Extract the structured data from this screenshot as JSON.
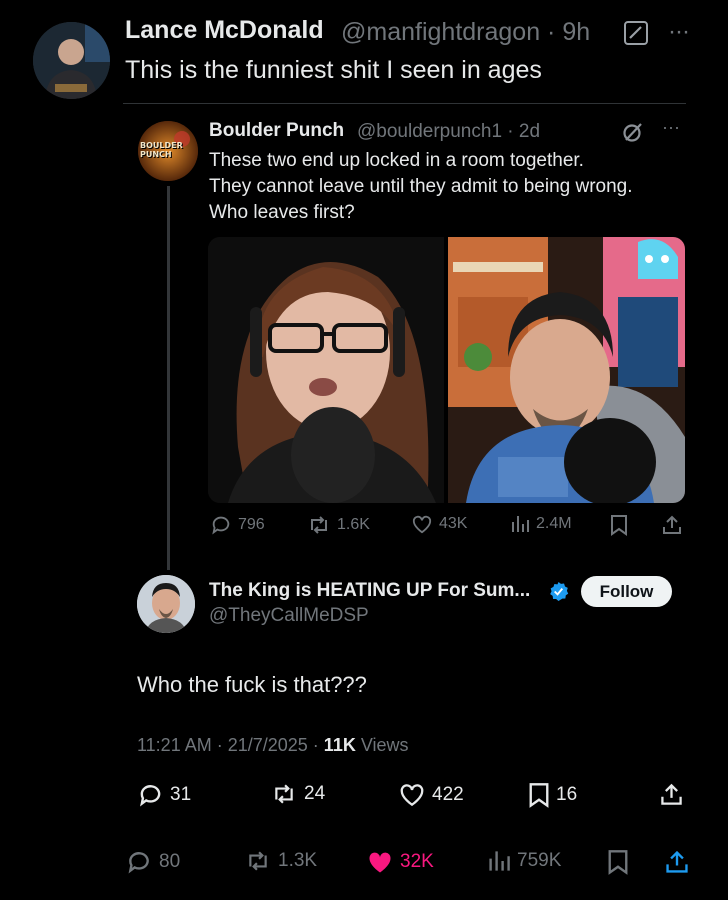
{
  "top_tweet": {
    "author_name": "Lance McDonald",
    "handle_time": "@manfightdragon · 9h",
    "text": "This is the funniest shit I seen in ages",
    "more": "···"
  },
  "quoted_tweet": {
    "author_name": "Boulder Punch",
    "handle_time": "@boulderpunch1 · 2d",
    "avatar_logo_text": "BOULDER PUNCH",
    "more": "···",
    "text_lines": [
      "These two end up locked in a room together.",
      "They cannot leave until they admit to being wrong.",
      "Who leaves first?"
    ],
    "stats": {
      "replies": "796",
      "reposts": "1.6K",
      "likes": "43K",
      "views": "2.4M"
    }
  },
  "reply": {
    "author_name": "The King is HEATING UP For Sum...",
    "handle": "@TheyCallMeDSP",
    "follow_label": "Follow",
    "text": "Who the fuck is that???",
    "timestamp": "11:21 AM · 21/7/2025 · ",
    "views_count": "11K",
    "views_label": " Views",
    "stats": {
      "replies": "31",
      "reposts": "24",
      "likes": "422",
      "bookmarks": "16"
    }
  },
  "bottom_bar": {
    "replies": "80",
    "reposts": "1.3K",
    "likes": "32K",
    "views": "759K"
  },
  "colors": {
    "background": "#000000",
    "text": "#e7e9ea",
    "muted": "#71767b",
    "like_active": "#f91880",
    "share_blue": "#1d9bf0",
    "verified": "#1d9bf0"
  }
}
